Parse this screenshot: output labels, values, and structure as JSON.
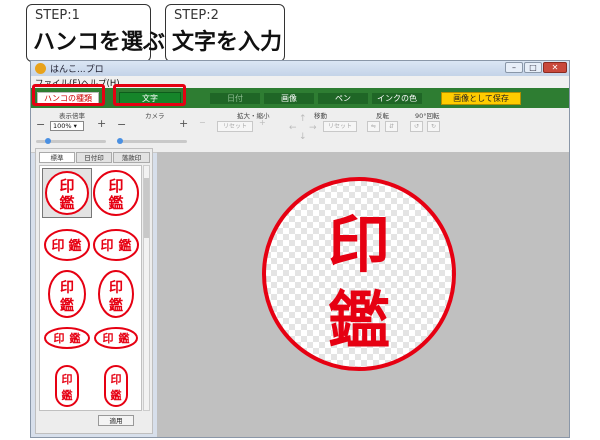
{
  "callouts": [
    {
      "step": "STEP:1",
      "title": "ハンコを選ぶ"
    },
    {
      "step": "STEP:2",
      "title": "文字を入力"
    }
  ],
  "window": {
    "title": "はんこ...プロ",
    "controls": {
      "minimize": "–",
      "maximize": "□",
      "close": "✕"
    }
  },
  "menu": [
    "ファイル(F)",
    "ヘルプ(H)"
  ],
  "toolbar": {
    "hanko_type": "ハンコの種類",
    "text": "文字",
    "date": "日付",
    "image": "画像",
    "pen": "ペン",
    "ink_color": "インクの色",
    "save_as_image": "画像として保存"
  },
  "controls": {
    "zoom_label": "表示倍率",
    "zoom_value": "100%",
    "camera_label": "カメラ",
    "scale_label": "拡大・縮小",
    "move_label": "移動",
    "flip_label": "反転",
    "rotate_label": "90°回転",
    "reset_label": "リセット"
  },
  "panel": {
    "tabs": [
      "標準",
      "日付印",
      "落款印"
    ],
    "apply": "適用",
    "stamp_text_1": "印",
    "stamp_text_2": "鑑"
  },
  "preview": {
    "char_1": "印",
    "char_2": "鑑",
    "ink_color": "#e60012"
  }
}
